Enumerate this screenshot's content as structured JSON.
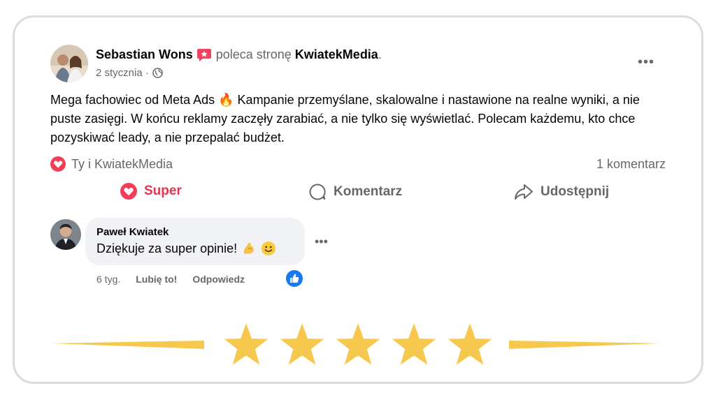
{
  "post": {
    "author": "Sebastian Wons",
    "recommends_text": "poleca stronę",
    "page_name": "KwiatekMedia",
    "period": ".",
    "date": "2 stycznia ·",
    "more_label": "•••",
    "body": "Mega fachowiec od Meta Ads 🔥 Kampanie przemyślane, skalowalne i nastawione na realne wyniki, a nie puste zasięgi. W końcu reklamy zaczęły zarabiać, a nie tylko się wyświetlać. Polecam każdemu, kto chce pozyskiwać leady, a nie przepalać budżet."
  },
  "reactions": {
    "summary": "Ty i KwiatekMedia",
    "comments_count": "1 komentarz"
  },
  "actions": {
    "super_label": "Super",
    "comment_label": "Komentarz",
    "share_label": "Udostępnij"
  },
  "comment": {
    "author": "Paweł Kwiatek",
    "text": "Dziękuje za super opinie!",
    "more_label": "•••",
    "time": "6 tyg.",
    "like_label": "Lubię to!",
    "reply_label": "Odpowiedz"
  },
  "rating": {
    "stars": 5,
    "max_stars": 5
  },
  "colors": {
    "super_red": "#e8334e",
    "like_blue": "#1877f2",
    "star_gold": "#f6c94e",
    "secondary_text": "#65676b",
    "bubble_bg": "#f0f2f5"
  }
}
